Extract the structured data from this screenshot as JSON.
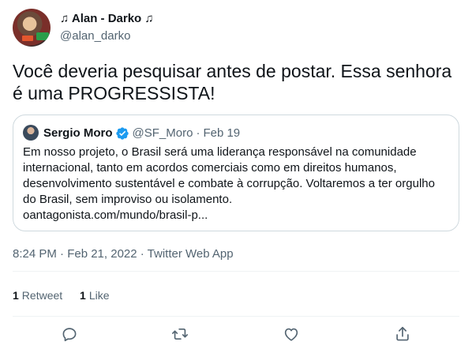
{
  "tweet": {
    "author_name": "♫ Alan - Darko ♫",
    "author_handle": "@alan_darko",
    "text": "Você deveria pesquisar antes de postar. Essa senhora é uma PROGRESSISTA!",
    "timestamp": "8:24 PM · Feb 21, 2022 · Twitter Web App"
  },
  "quote": {
    "author_name": "Sergio Moro",
    "author_handle": "@SF_Moro",
    "separator": "·",
    "date": "Feb 19",
    "text": "Em nosso projeto, o Brasil será uma liderança responsável na comunidade internacional, tanto em acordos comerciais como em direitos humanos, desenvolvimento sustentável e combate à corrupção. Voltaremos a ter orgulho do Brasil, sem improviso ou isolamento.",
    "link": "oantagonista.com/mundo/brasil-p..."
  },
  "stats": {
    "retweets_count": "1",
    "retweets_label": "Retweet",
    "likes_count": "1",
    "likes_label": "Like"
  },
  "actions": [
    "reply-icon",
    "retweet-icon",
    "like-icon",
    "share-icon"
  ],
  "colors": {
    "text": "#0f1419",
    "secondary": "#536471",
    "border": "#cfd9de",
    "verified": "#1d9bf0"
  }
}
